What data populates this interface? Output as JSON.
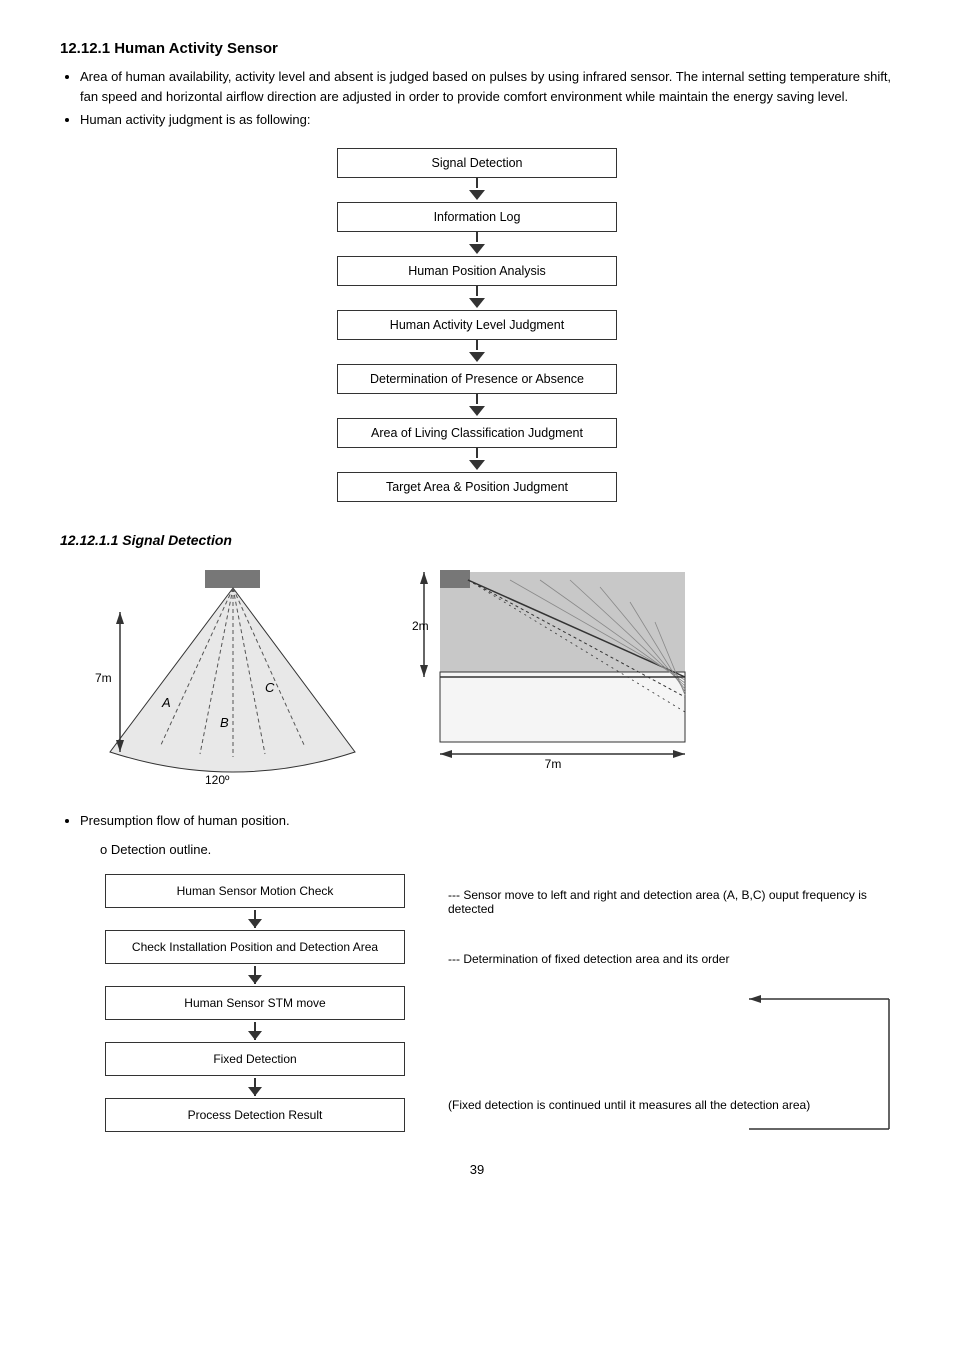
{
  "section": {
    "title": "12.12.1  Human Activity Sensor",
    "bullets": [
      "Area of human availability, activity level and absent is judged based on pulses by using infrared sensor. The internal setting temperature shift, fan speed and horizontal airflow direction are adjusted in order to provide comfort environment while maintain the energy saving level.",
      "Human activity judgment is as following:"
    ]
  },
  "flowchart": {
    "boxes": [
      "Signal Detection",
      "Information Log",
      "Human Position Analysis",
      "Human Activity Level Judgment",
      "Determination of Presence or Absence",
      "Area of Living Classification Judgment",
      "Target Area & Position Judgment"
    ]
  },
  "subsection": {
    "title": "12.12.1.1   Signal Detection"
  },
  "diagram": {
    "fan_labels": {
      "width": "7m",
      "angle": "120º",
      "zones": [
        "A",
        "B",
        "C"
      ]
    },
    "side_labels": {
      "height": "2m",
      "width": "7m"
    }
  },
  "presumption": {
    "bullet1": "Presumption flow of human position.",
    "sub1": "Detection outline."
  },
  "detection_flow": {
    "boxes": [
      "Human Sensor Motion Check",
      "Check Installation Position and Detection Area",
      "Human Sensor STM move",
      "Fixed Detection",
      "Process Detection Result"
    ],
    "notes": [
      "--- Sensor move to left and right and detection area (A, B,C) ouput frequency is detected",
      "--- Determination of fixed detection area and its order",
      "",
      "(Fixed detection is continued until it measures all the detection area)"
    ]
  },
  "page_number": "39"
}
